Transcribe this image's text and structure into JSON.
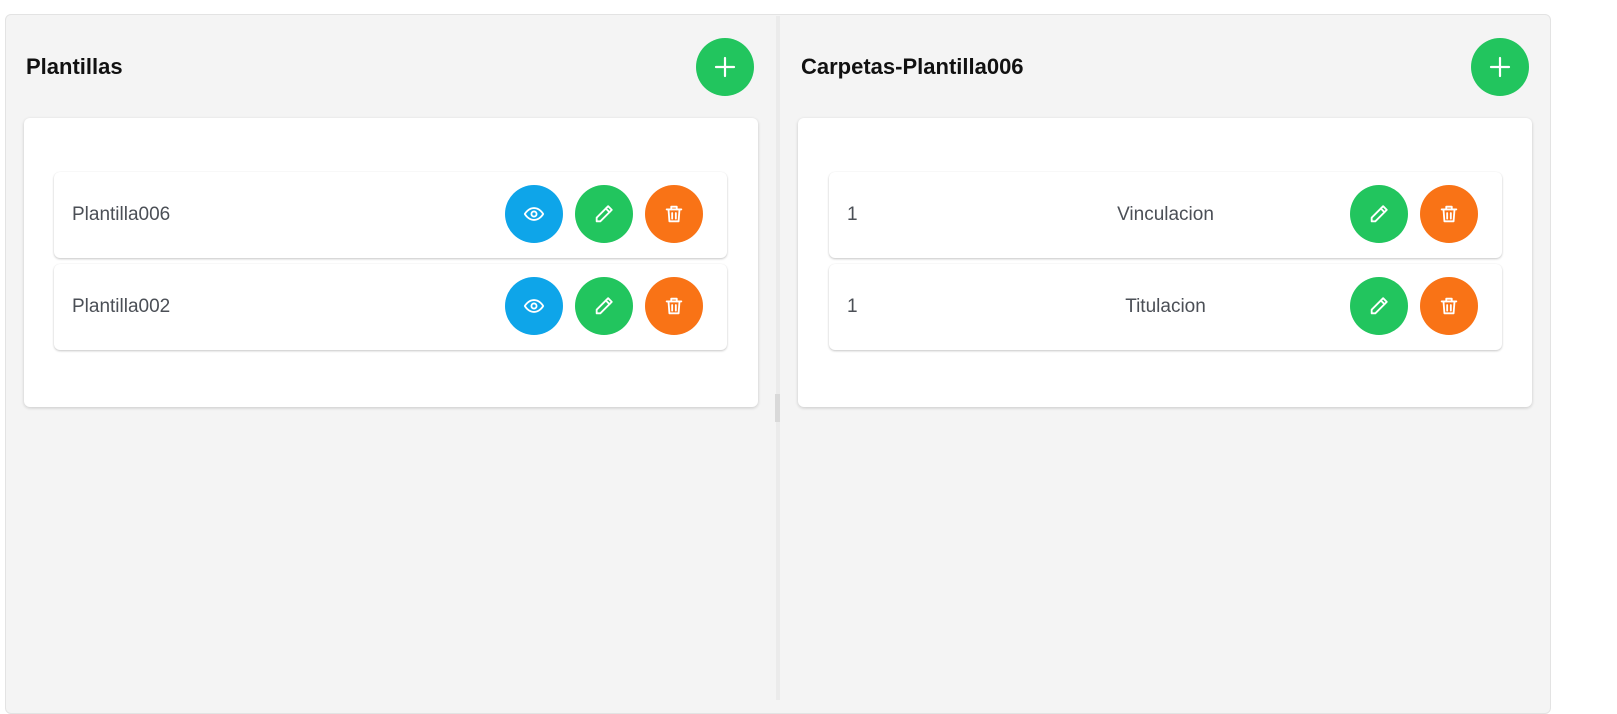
{
  "left_panel": {
    "title": "Plantillas",
    "add_icon": "plus-icon",
    "items": [
      {
        "name": "Plantilla006"
      },
      {
        "name": "Plantilla002"
      }
    ]
  },
  "right_panel": {
    "title": "Carpetas-Plantilla006",
    "add_icon": "plus-icon",
    "items": [
      {
        "number": "1",
        "name": "Vinculacion"
      },
      {
        "number": "1",
        "name": "Titulacion"
      }
    ]
  },
  "icons": {
    "view": "eye-icon",
    "edit": "pencil-icon",
    "delete": "trash-icon"
  },
  "colors": {
    "add": "#22c55e",
    "view": "#0ea5e9",
    "edit": "#22c55e",
    "delete": "#f97316",
    "background": "#f4f4f4"
  }
}
